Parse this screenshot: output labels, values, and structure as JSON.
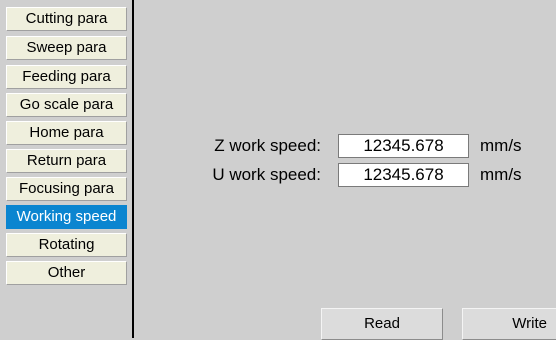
{
  "sidebar": {
    "items": [
      {
        "label": "Cutting para"
      },
      {
        "label": "Sweep para"
      },
      {
        "label": "Feeding para"
      },
      {
        "label": "Go scale para"
      },
      {
        "label": "Home para"
      },
      {
        "label": "Return para"
      },
      {
        "label": "Focusing para"
      },
      {
        "label": "Working speed",
        "active": true
      },
      {
        "label": "Rotating"
      },
      {
        "label": "Other"
      }
    ]
  },
  "main": {
    "fields": [
      {
        "label": "Z work speed:",
        "value": "12345.678",
        "unit": "mm/s"
      },
      {
        "label": "U work speed:",
        "value": "12345.678",
        "unit": "mm/s"
      }
    ],
    "buttons": {
      "read": "Read",
      "write": "Write"
    }
  },
  "colors": {
    "background": "#cfcfcf",
    "menu_item": "#efefdd",
    "active_item": "#0b85d0",
    "divider": "#000000"
  }
}
